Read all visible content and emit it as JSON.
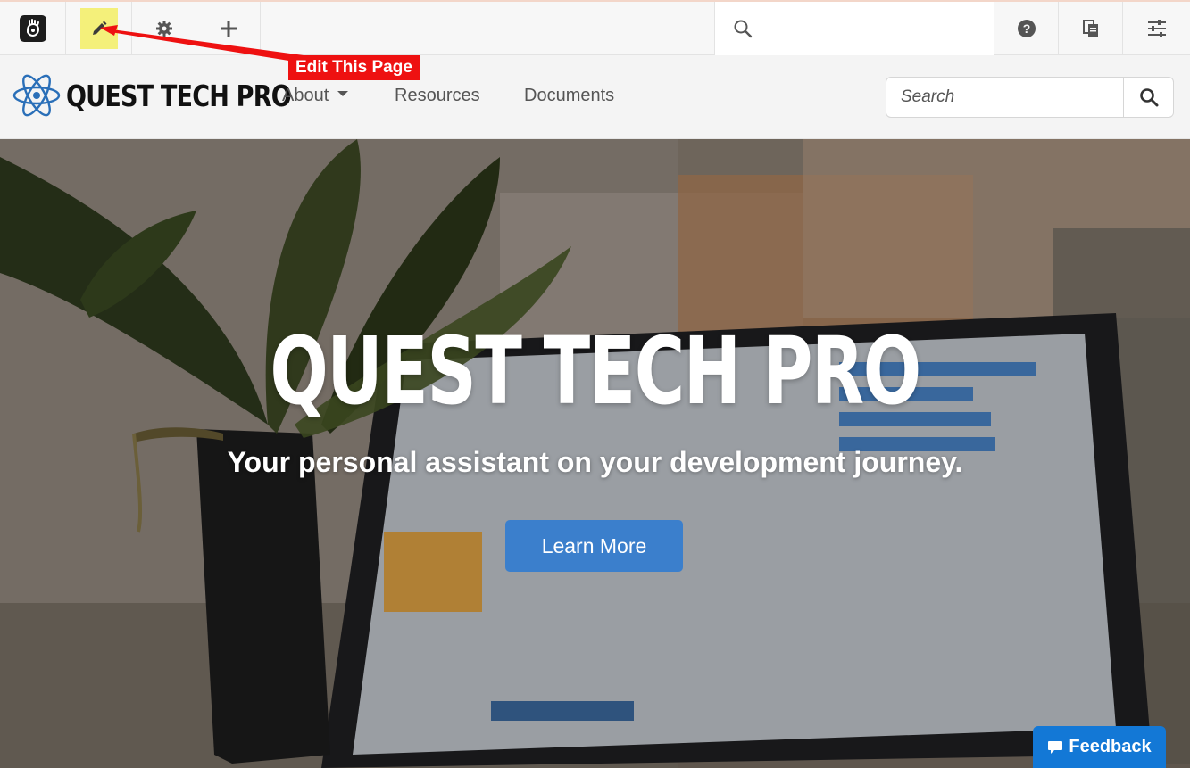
{
  "cms_toolbar": {
    "logo_icon": "concrete-hand-logo-icon",
    "edit_icon": "pencil-icon",
    "settings_icon": "gear-icon",
    "add_icon": "plus-icon",
    "search_icon": "search-icon",
    "help_icon": "question-circle-icon",
    "pages_icon": "copy-pages-icon",
    "panel_icon": "sliders-icon",
    "edit_highlight_color": "#f4f07a"
  },
  "annotation": {
    "label": "Edit This Page",
    "color": "#ee1111"
  },
  "navbar": {
    "brand_name": "QUEST TECH PRO",
    "brand_icon": "atom-icon",
    "items": [
      {
        "label": "About",
        "has_dropdown": true
      },
      {
        "label": "Resources"
      },
      {
        "label": "Documents"
      }
    ],
    "search": {
      "placeholder": "Search",
      "button_icon": "search-icon"
    }
  },
  "hero": {
    "title": "QUEST TECH PRO",
    "subtitle": "Your personal assistant on your development journey.",
    "button_label": "Learn More",
    "button_color": "#3b7fcc"
  },
  "feedback": {
    "label": "Feedback",
    "icon": "speech-bubble-icon",
    "color": "#1378d6"
  }
}
